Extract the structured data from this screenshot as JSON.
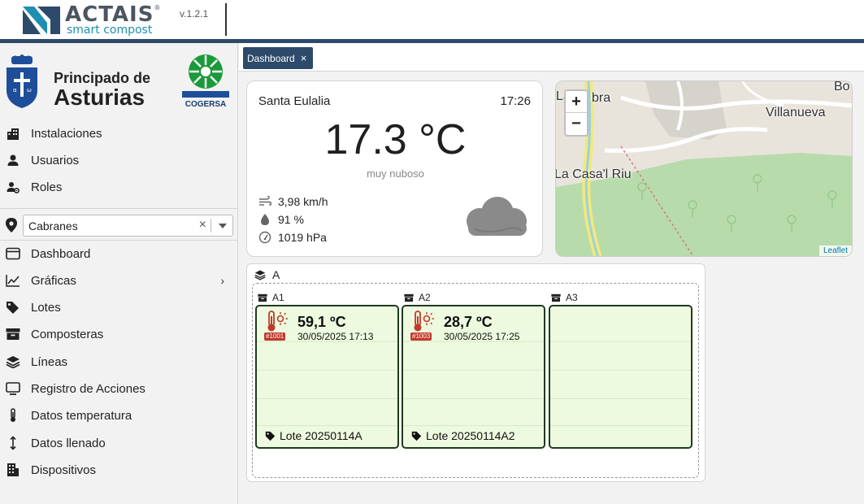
{
  "header": {
    "brand": "ACTAIS",
    "trademark": "®",
    "subtitle": "smart compost",
    "version": "v.1.2.1"
  },
  "sidebar": {
    "org_line1": "Principado de",
    "org_line2": "Asturias",
    "partner": "COGERSA",
    "top_items": [
      {
        "label": "Instalaciones",
        "icon": "building-icon"
      },
      {
        "label": "Usuarios",
        "icon": "user-icon"
      },
      {
        "label": "Roles",
        "icon": "user-gear-icon"
      }
    ],
    "location": {
      "value": "Cabranes",
      "clear": "×"
    },
    "items": [
      {
        "label": "Dashboard",
        "icon": "window-icon"
      },
      {
        "label": "Gráficas",
        "icon": "line-chart-icon"
      },
      {
        "label": "Lotes",
        "icon": "tags-icon"
      },
      {
        "label": "Composteras",
        "icon": "archive-icon"
      },
      {
        "label": "Líneas",
        "icon": "layers-icon"
      },
      {
        "label": "Registro de Acciones",
        "icon": "monitor-icon"
      },
      {
        "label": "Datos temperatura",
        "icon": "thermometer-icon"
      },
      {
        "label": "Datos llenado",
        "icon": "arrows-vertical-icon"
      },
      {
        "label": "Dispositivos",
        "icon": "building-icon"
      }
    ],
    "chevron": "›"
  },
  "tabs": [
    {
      "label": "Dashboard",
      "close": "×"
    }
  ],
  "weather": {
    "location": "Santa Eulalia",
    "time": "17:26",
    "temperature": "17.3 °C",
    "description": "muy nuboso",
    "wind": "3,98 km/h",
    "humidity": "91 %",
    "pressure": "1019 hPa",
    "icon": "cloud-icon"
  },
  "map": {
    "zoom_in": "+",
    "zoom_out": "−",
    "labels": [
      "Bo",
      "La",
      "bra",
      "Villanueva",
      "La Casa'l Riu"
    ],
    "attribution": "Leaflet"
  },
  "line": {
    "name": "A",
    "bins": [
      {
        "name": "A1",
        "temp": "59,1 ºC",
        "date": "30/05/2025 17:13",
        "device": "#1001",
        "lote": "Lote 20250114A"
      },
      {
        "name": "A2",
        "temp": "28,7 ºC",
        "date": "30/05/2025 17:25",
        "device": "#1003",
        "lote": "Lote 20250114A2"
      },
      {
        "name": "A3",
        "temp": "",
        "date": "",
        "device": "",
        "lote": ""
      }
    ]
  },
  "colors": {
    "header_bar": "#2e4a6b",
    "brand_sub": "#1e8fb0",
    "bin_bg": "#eefadf",
    "bin_border": "#1f3a1f",
    "alert_red": "#c0392b"
  }
}
